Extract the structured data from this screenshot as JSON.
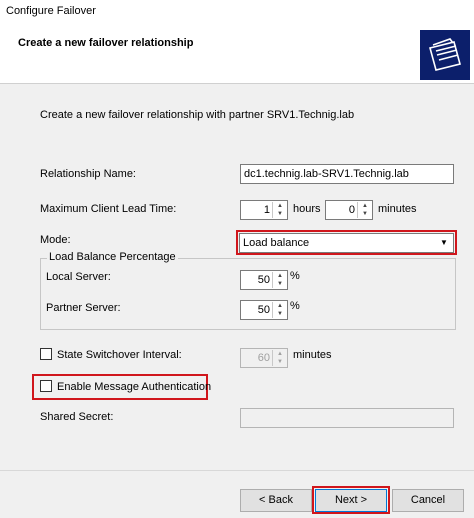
{
  "window": {
    "title": "Configure Failover"
  },
  "header": {
    "heading": "Create a new failover relationship",
    "icon": "folder-stack-icon"
  },
  "intro": "Create a new failover relationship with partner SRV1.Technig.lab",
  "relationship_name": {
    "label": "Relationship Name:",
    "value": "dc1.technig.lab-SRV1.Technig.lab"
  },
  "mclt": {
    "label": "Maximum Client Lead Time:",
    "hours_value": "1",
    "hours_label": "hours",
    "minutes_value": "0",
    "minutes_label": "minutes"
  },
  "mode": {
    "label": "Mode:",
    "value": "Load balance"
  },
  "load_balance": {
    "legend": "Load Balance Percentage",
    "local_label": "Local Server:",
    "local_value": "50",
    "local_unit": "%",
    "partner_label": "Partner Server:",
    "partner_value": "50",
    "partner_unit": "%"
  },
  "switchover": {
    "label": "State Switchover Interval:",
    "value": "60",
    "unit": "minutes",
    "checked": false
  },
  "message_auth": {
    "label": "Enable Message Authentication",
    "checked": false
  },
  "shared_secret": {
    "label": "Shared Secret:",
    "value": ""
  },
  "buttons": {
    "back": "< Back",
    "next": "Next >",
    "cancel": "Cancel"
  },
  "colors": {
    "highlight": "#d0161c",
    "icon_bg": "#0c1f6b"
  }
}
